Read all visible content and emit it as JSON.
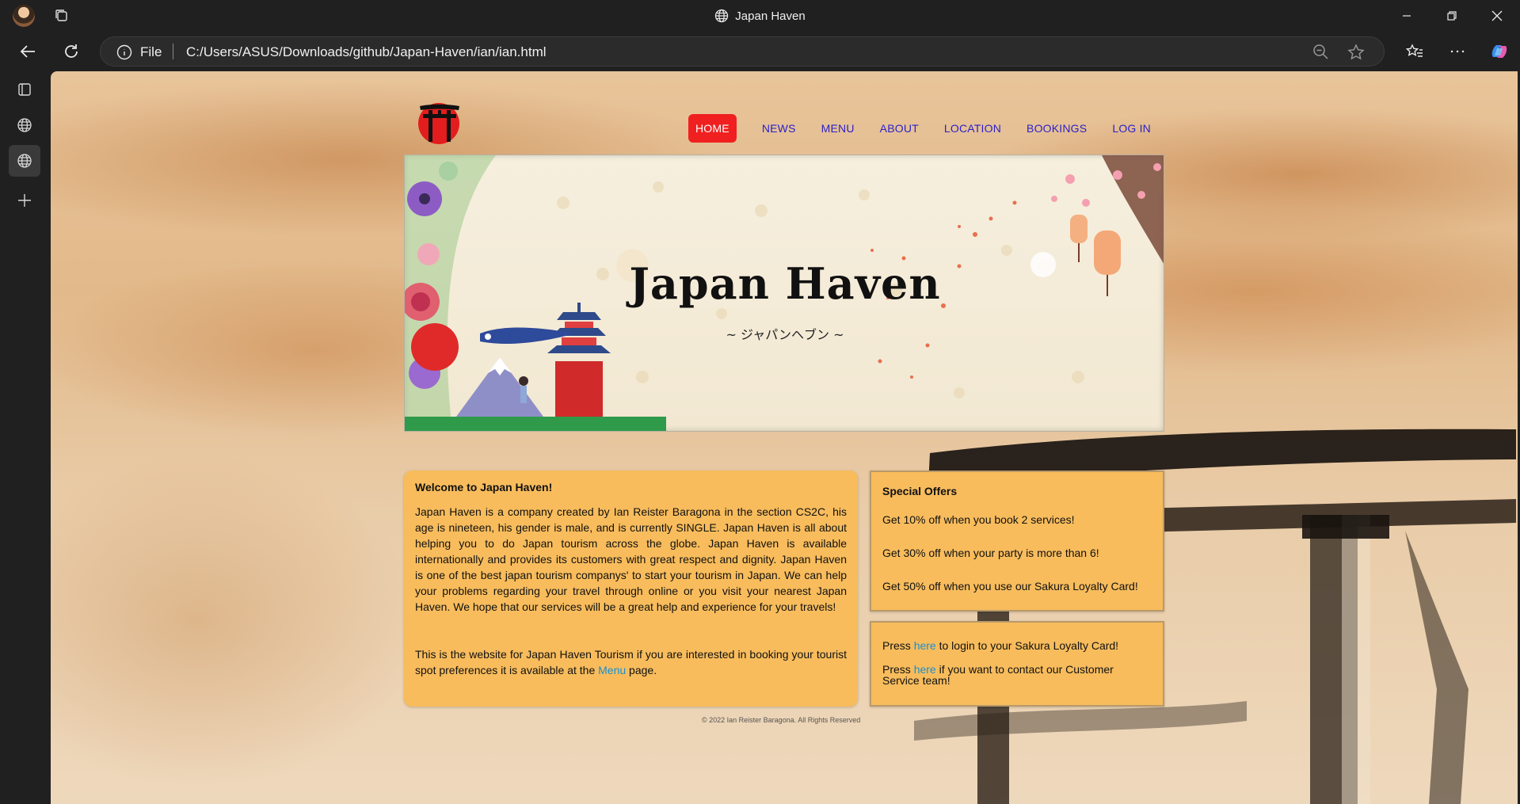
{
  "browser": {
    "window_title": "Japan Haven",
    "address": {
      "scheme_label": "File",
      "url": "C:/Users/ASUS/Downloads/github/Japan-Haven/ian/ian.html"
    }
  },
  "site": {
    "nav": {
      "items": [
        "HOME",
        "NEWS",
        "MENU",
        "ABOUT",
        "LOCATION",
        "BOOKINGS",
        "LOG IN"
      ],
      "active": "HOME"
    },
    "hero": {
      "title": "Japan Haven",
      "subtitle": "~ ジャパンヘブン ~"
    },
    "welcome": {
      "heading": "Welcome to Japan Haven!",
      "paragraph1": "Japan Haven is a company created by Ian Reister Baragona in the section CS2C, his age is nineteen, his gender is male, and is currently SINGLE. Japan Haven is all about helping you to do Japan tourism across the globe. Japan Haven is available internationally and provides its customers with great respect and dignity. Japan Haven is one of the best japan tourism companys' to start your tourism in Japan. We can help your problems regarding your travel through online or you visit your nearest Japan Haven. We hope that our services will be a great help and experience for your travels!",
      "paragraph2_pre": "This is the website for Japan Haven Tourism if you are interested in booking your tourist spot preferences it is available at the ",
      "paragraph2_link": "Menu",
      "paragraph2_post": " page."
    },
    "offers": {
      "heading": "Special Offers",
      "items": [
        "Get 10% off when you book 2 services!",
        "Get 30% off when your party is more than 6!",
        "Get 50% off when you use our Sakura Loyalty Card!"
      ]
    },
    "loyalty": {
      "line1_pre": "Press ",
      "line1_link": "here",
      "line1_post": " to login to your Sakura Loyalty Card!",
      "line2_pre": "Press ",
      "line2_link": "here",
      "line2_post": " if you want to contact our Customer Service team!"
    },
    "footer": "© 2022 Ian Reister Baragona. All Rights Reserved"
  },
  "colors": {
    "box": "#f8bc5c",
    "nav_link": "#2a1fc8",
    "home_active": "#f02020",
    "link": "#1a8fd0"
  }
}
